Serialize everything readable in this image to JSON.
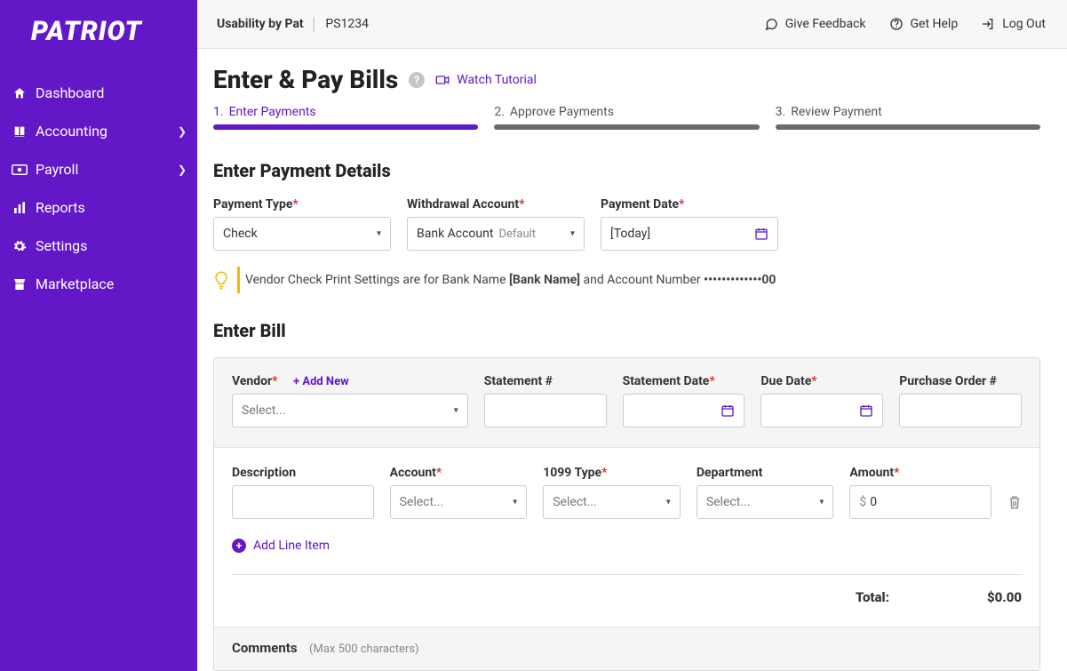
{
  "brand": "PATRIOT",
  "company": {
    "name": "Usability by Pat",
    "id": "PS1234"
  },
  "topbar": {
    "feedback": "Give Feedback",
    "help": "Get Help",
    "logout": "Log Out"
  },
  "nav": {
    "items": [
      {
        "label": "Dashboard",
        "icon": "home",
        "expandable": false
      },
      {
        "label": "Accounting",
        "icon": "book",
        "expandable": true
      },
      {
        "label": "Payroll",
        "icon": "money",
        "expandable": true
      },
      {
        "label": "Reports",
        "icon": "bar",
        "expandable": false
      },
      {
        "label": "Settings",
        "icon": "gear",
        "expandable": false
      },
      {
        "label": "Marketplace",
        "icon": "store",
        "expandable": false
      }
    ]
  },
  "page": {
    "title": "Enter & Pay Bills",
    "tutorial": "Watch Tutorial"
  },
  "steps": [
    {
      "num": "1.",
      "label": "Enter Payments",
      "active": true
    },
    {
      "num": "2.",
      "label": "Approve Payments",
      "active": false
    },
    {
      "num": "3.",
      "label": "Review Payment",
      "active": false
    }
  ],
  "section1": {
    "title": "Enter Payment Details"
  },
  "paymentType": {
    "label": "Payment Type",
    "value": "Check"
  },
  "withdrawal": {
    "label": "Withdrawal Account",
    "value": "Bank Account",
    "tag": "Default"
  },
  "paymentDate": {
    "label": "Payment Date",
    "value": "[Today]"
  },
  "banner": {
    "prefix": "Vendor Check Print Settings are for Bank Name ",
    "bank": "[Bank Name]",
    "mid": " and Account Number ",
    "masked": "•••••••••••••00"
  },
  "section2": {
    "title": "Enter Bill"
  },
  "vendor": {
    "label": "Vendor",
    "placeholder": "Select...",
    "addNew": "+ Add New"
  },
  "statementNum": {
    "label": "Statement #"
  },
  "statementDate": {
    "label": "Statement Date"
  },
  "dueDate": {
    "label": "Due Date"
  },
  "poNum": {
    "label": "Purchase Order #"
  },
  "line": {
    "description": {
      "label": "Description"
    },
    "account": {
      "label": "Account",
      "placeholder": "Select..."
    },
    "t1099": {
      "label": "1099 Type",
      "placeholder": "Select..."
    },
    "department": {
      "label": "Department",
      "placeholder": "Select..."
    },
    "amount": {
      "label": "Amount",
      "currency": "$",
      "value": "0"
    }
  },
  "addLine": "Add Line Item",
  "total": {
    "label": "Total:",
    "value": "$0.00"
  },
  "comments": {
    "label": "Comments",
    "hint": "(Max 500 characters)"
  }
}
